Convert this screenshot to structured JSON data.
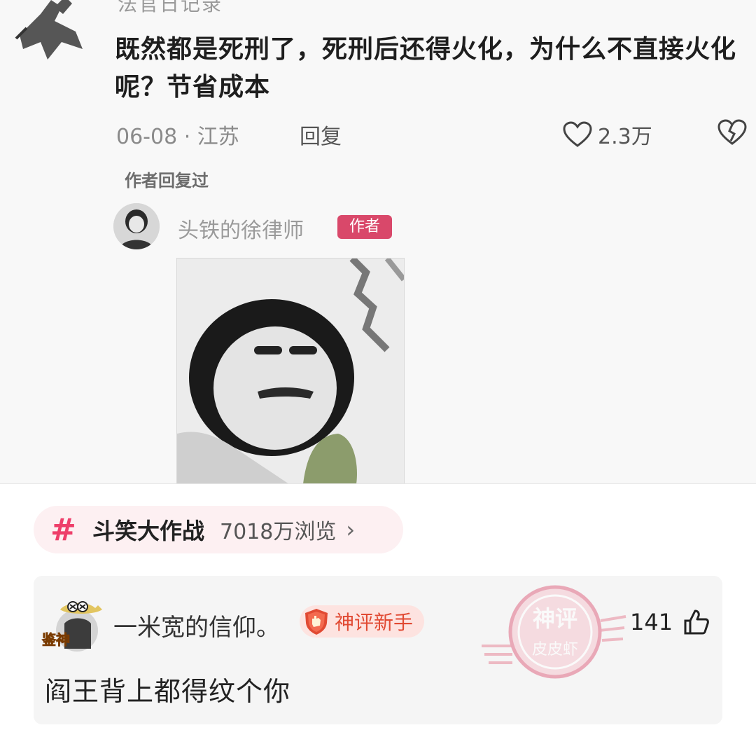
{
  "post": {
    "cut_username": "法官日记录",
    "question": "既然都是死刑了，死刑后还得火化，为什么不直接火化呢？节省成本",
    "date_location": "06-08 · 江苏",
    "reply_label": "回复",
    "like_count": "2.3万"
  },
  "author_reply": {
    "indicator": "作者回复过",
    "username": "头铁的徐律师",
    "author_tag": "作者"
  },
  "topic": {
    "hash": "#",
    "title": "斗笑大作战",
    "views": "7018万浏览",
    "arrow": "›"
  },
  "comment": {
    "username": "一米宽的信仰。",
    "badge": "神评新手",
    "likes": "141",
    "text": "阎王背上都得纹个你",
    "avatar_sticker": "鉴神"
  },
  "watermark": {
    "line1": "神评",
    "line2": "皮皮虾"
  },
  "colors": {
    "accent_pink": "#ee3f6a",
    "author_tag": "#d9486a",
    "badge_red": "#e14a33"
  }
}
